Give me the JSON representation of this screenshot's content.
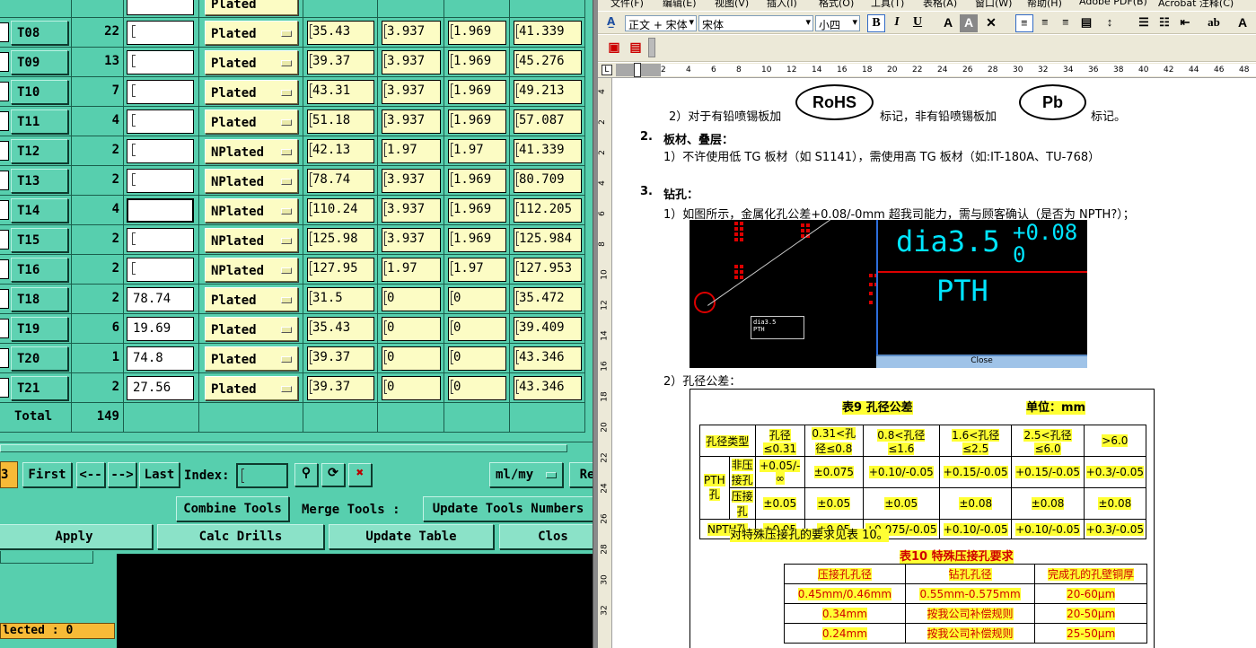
{
  "tool_table": {
    "top_partial_label": "Plated",
    "rows": [
      {
        "tool": "T08",
        "count": "22",
        "size": "",
        "plating": "Plated",
        "c1": "35.43",
        "c2": "3.937",
        "c3": "1.969",
        "c4": "41.339"
      },
      {
        "tool": "T09",
        "count": "13",
        "size": "",
        "plating": "Plated",
        "c1": "39.37",
        "c2": "3.937",
        "c3": "1.969",
        "c4": "45.276"
      },
      {
        "tool": "T10",
        "count": "7",
        "size": "",
        "plating": "Plated",
        "c1": "43.31",
        "c2": "3.937",
        "c3": "1.969",
        "c4": "49.213"
      },
      {
        "tool": "T11",
        "count": "4",
        "size": "",
        "plating": "Plated",
        "c1": "51.18",
        "c2": "3.937",
        "c3": "1.969",
        "c4": "57.087"
      },
      {
        "tool": "T12",
        "count": "2",
        "size": "",
        "plating": "NPlated",
        "c1": "42.13",
        "c2": "1.97",
        "c3": "1.97",
        "c4": "41.339"
      },
      {
        "tool": "T13",
        "count": "2",
        "size": "",
        "plating": "NPlated",
        "c1": "78.74",
        "c2": "3.937",
        "c3": "1.969",
        "c4": "80.709"
      },
      {
        "tool": "T14",
        "count": "4",
        "size": "",
        "plating": "NPlated",
        "c1": "110.24",
        "c2": "3.937",
        "c3": "1.969",
        "c4": "112.205"
      },
      {
        "tool": "T15",
        "count": "2",
        "size": "",
        "plating": "NPlated",
        "c1": "125.98",
        "c2": "3.937",
        "c3": "1.969",
        "c4": "125.984"
      },
      {
        "tool": "T16",
        "count": "2",
        "size": "",
        "plating": "NPlated",
        "c1": "127.95",
        "c2": "1.97",
        "c3": "1.97",
        "c4": "127.953"
      },
      {
        "tool": "T18",
        "count": "2",
        "size": "78.74",
        "plating": "Plated",
        "c1": "31.5",
        "c2": "0",
        "c3": "0",
        "c4": "35.472"
      },
      {
        "tool": "T19",
        "count": "6",
        "size": "19.69",
        "plating": "Plated",
        "c1": "35.43",
        "c2": "0",
        "c3": "0",
        "c4": "39.409"
      },
      {
        "tool": "T20",
        "count": "1",
        "size": "74.8",
        "plating": "Plated",
        "c1": "39.37",
        "c2": "0",
        "c3": "0",
        "c4": "43.346"
      },
      {
        "tool": "T21",
        "count": "2",
        "size": "27.56",
        "plating": "Plated",
        "c1": "39.37",
        "c2": "0",
        "c3": "0",
        "c4": "43.346"
      }
    ],
    "total_label": "Total",
    "total_count": "149"
  },
  "nav": {
    "page_fragment": "3",
    "first": "First",
    "prev": "<--",
    "next": "-->",
    "last": "Last",
    "index_label": "Index:",
    "units": "ml/my",
    "re_fragment": "Re"
  },
  "actions": {
    "combine": "Combine Tools",
    "merge_label": "Merge Tools :",
    "update_numbers": "Update Tools Numbers",
    "apply": "Apply",
    "calc": "Calc Drills",
    "update_table": "Update Table",
    "close_fragment": "Clos"
  },
  "status": {
    "selected": "lected : 0"
  },
  "word": {
    "menus": [
      "文件(F)",
      "编辑(E)",
      "视图(V)",
      "插入(I)",
      "格式(O)",
      "工具(T)",
      "表格(A)",
      "窗口(W)",
      "帮助(H)",
      "Adobe PDF(B)",
      "Acrobat 注释(C)"
    ],
    "style_box": "正文 + 宋体",
    "font_box": "宋体",
    "size_box": "小四",
    "ruler_ticks": [
      "2",
      "4",
      "6",
      "8",
      "10",
      "12",
      "14",
      "16",
      "18",
      "20",
      "22",
      "24",
      "26",
      "28",
      "30",
      "32",
      "34",
      "36",
      "38",
      "40",
      "42",
      "44",
      "46",
      "48"
    ],
    "vruler_ticks": [
      "4",
      "2",
      "2",
      "4",
      "6",
      "8",
      "10",
      "12",
      "14",
      "16",
      "18",
      "20",
      "22",
      "24",
      "26",
      "28",
      "30",
      "32"
    ],
    "line_rohs_a": "2）对于有铅喷锡板加",
    "rohs": "RoHS",
    "line_rohs_b": "标记，非有铅喷锡板加",
    "pb": "Pb",
    "line_rohs_c": "标记。",
    "sec2_num": "2.",
    "sec2_title": "板材、叠层：",
    "sec2_item": "1）不许使用低 TG 板材（如 S1141），需使用高 TG 板材（如:IT-180A、TU-768）",
    "sec3_num": "3.",
    "sec3_title": "钻孔：",
    "sec3_item1": "1）如图所示，金属化孔公差+0.08/-0mm 超我司能力，需与顾客确认（是否为 NPTH?）；",
    "pic_dia": "dia3.5",
    "pic_sup": "+0.08",
    "pic_sub": "0",
    "pic_pth": "PTH",
    "pic_close": "Close",
    "sec3_item2": "2）孔径公差：",
    "table9_title": "表9  孔径公差",
    "table9_unit": "单位：mm",
    "table9_header": [
      "孔径类型",
      "孔径≤0.31",
      "0.31<孔径≤0.8",
      "0.8<孔径≤1.6",
      "1.6<孔径≤2.5",
      "2.5<孔径≤6.0",
      ">6.0"
    ],
    "table9_rows": [
      {
        "g": "PTH孔",
        "type": "非压接孔",
        "v": [
          "+0.05/-∞",
          "±0.075",
          "+0.10/-0.05",
          "+0.15/-0.05",
          "+0.15/-0.05",
          "+0.3/-0.05"
        ]
      },
      {
        "g": "",
        "type": "压接孔",
        "v": [
          "±0.05",
          "±0.05",
          "±0.05",
          "±0.08",
          "±0.08",
          "±0.08"
        ]
      },
      {
        "g": "",
        "type": "NPTH孔",
        "v": [
          "±0.05",
          "±0.05",
          "+0.075/-0.05",
          "+0.10/-0.05",
          "+0.10/-0.05",
          "+0.3/-0.05"
        ]
      }
    ],
    "special_note": "对特殊压接孔的要求见表 10。",
    "table10_title": "表10  特殊压接孔要求",
    "table10_header": [
      "压接孔孔径",
      "钻孔孔径",
      "完成孔的孔壁铜厚"
    ],
    "table10_rows": [
      [
        "0.45mm/0.46mm",
        "0.55mm-0.575mm",
        "20-60μm"
      ],
      [
        "0.34mm",
        "按我公司补偿规则",
        "20-50μm"
      ],
      [
        "0.24mm",
        "按我公司补偿规则",
        "25-50μm"
      ]
    ]
  }
}
